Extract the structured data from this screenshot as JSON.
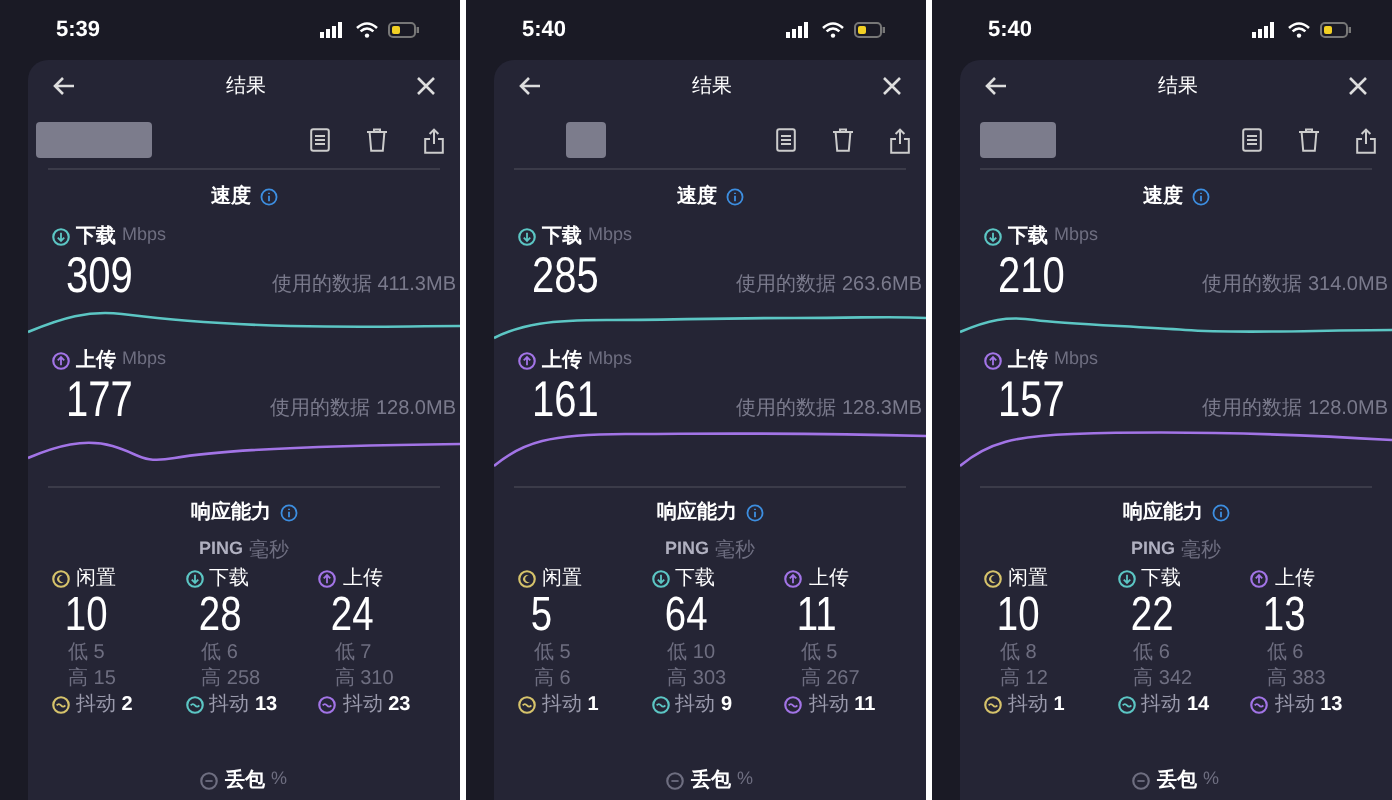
{
  "panels": [
    {
      "status_time": "5:39",
      "title": "结果",
      "speed": {
        "title": "速度",
        "download": {
          "label": "下载",
          "unit": "Mbps",
          "value": "309",
          "data_used": "使用的数据 411.3MB"
        },
        "upload": {
          "label": "上传",
          "unit": "Mbps",
          "value": "177",
          "data_used": "使用的数据 128.0MB"
        }
      },
      "responsiveness": {
        "title": "响应能力",
        "ping_label": "PING",
        "ping_unit": "毫秒",
        "columns": [
          {
            "label": "闲置",
            "color": "#d6c36b",
            "value": "10",
            "low": "低 5",
            "high": "高 15",
            "jitter": "抖动 **2**"
          },
          {
            "label": "下载",
            "color": "#5cc6c4",
            "value": "28",
            "low": "低 6",
            "high": "高 258",
            "jitter": "抖动 **13**"
          },
          {
            "label": "上传",
            "color": "#a274e6",
            "value": "24",
            "low": "低 7",
            "high": "高 310",
            "jitter": "抖动 **23**"
          }
        ]
      },
      "packet_loss": {
        "label": "丢包",
        "unit": "%"
      }
    },
    {
      "status_time": "5:40",
      "title": "结果",
      "speed": {
        "title": "速度",
        "download": {
          "label": "下载",
          "unit": "Mbps",
          "value": "285",
          "data_used": "使用的数据 263.6MB"
        },
        "upload": {
          "label": "上传",
          "unit": "Mbps",
          "value": "161",
          "data_used": "使用的数据 128.3MB"
        }
      },
      "responsiveness": {
        "title": "响应能力",
        "ping_label": "PING",
        "ping_unit": "毫秒",
        "columns": [
          {
            "label": "闲置",
            "color": "#d6c36b",
            "value": "5",
            "low": "低 5",
            "high": "高 6",
            "jitter": "抖动 **1**"
          },
          {
            "label": "下载",
            "color": "#5cc6c4",
            "value": "64",
            "low": "低 10",
            "high": "高 303",
            "jitter": "抖动 **9**"
          },
          {
            "label": "上传",
            "color": "#a274e6",
            "value": "11",
            "low": "低 5",
            "high": "高 267",
            "jitter": "抖动 **11**"
          }
        ]
      },
      "packet_loss": {
        "label": "丢包",
        "unit": "%"
      }
    },
    {
      "status_time": "5:40",
      "title": "结果",
      "speed": {
        "title": "速度",
        "download": {
          "label": "下载",
          "unit": "Mbps",
          "value": "210",
          "data_used": "使用的数据 314.0MB"
        },
        "upload": {
          "label": "上传",
          "unit": "Mbps",
          "value": "157",
          "data_used": "使用的数据 128.0MB"
        }
      },
      "responsiveness": {
        "title": "响应能力",
        "ping_label": "PING",
        "ping_unit": "毫秒",
        "columns": [
          {
            "label": "闲置",
            "color": "#d6c36b",
            "value": "10",
            "low": "低 8",
            "high": "高 12",
            "jitter": "抖动 **1**"
          },
          {
            "label": "下载",
            "color": "#5cc6c4",
            "value": "22",
            "low": "低 6",
            "high": "高 342",
            "jitter": "抖动 **14**"
          },
          {
            "label": "上传",
            "color": "#a274e6",
            "value": "13",
            "low": "低 6",
            "high": "高 383",
            "jitter": "抖动 **13**"
          }
        ]
      },
      "packet_loss": {
        "label": "丢包",
        "unit": "%"
      }
    }
  ]
}
